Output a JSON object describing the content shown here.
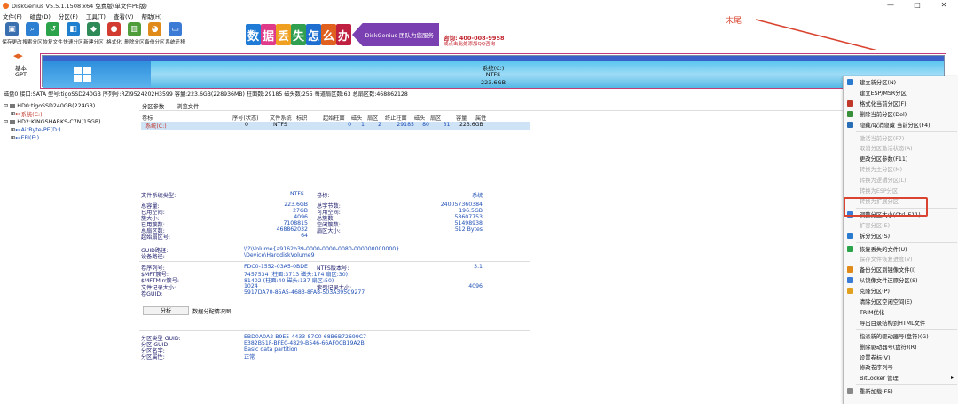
{
  "window": {
    "title": "DiskGenius V5.5.1.1508 x64 免费版(单文件PE版)",
    "minimize": "—",
    "maximize": "□",
    "close": "✕"
  },
  "menu": [
    "文件(F)",
    "磁盘(D)",
    "分区(P)",
    "工具(T)",
    "查看(V)",
    "帮助(H)"
  ],
  "toolbar": [
    {
      "label": "保存更改",
      "icon": "save-icon",
      "color": "#3a6fb0"
    },
    {
      "label": "搜索分区",
      "icon": "search-icon",
      "color": "#2c7fd1"
    },
    {
      "label": "恢复文件",
      "icon": "recover-icon",
      "color": "#2aa34a"
    },
    {
      "label": "快速分区",
      "icon": "quick-partition-icon",
      "color": "#1f7fcf"
    },
    {
      "label": "新建分区",
      "icon": "new-partition-icon",
      "color": "#2e8b57"
    },
    {
      "label": "格式化",
      "icon": "format-icon",
      "color": "#d23b2f"
    },
    {
      "label": "删除分区",
      "icon": "delete-icon",
      "color": "#4f9d3a"
    },
    {
      "label": "备份分区",
      "icon": "backup-icon",
      "color": "#e08a1a"
    },
    {
      "label": "系统迁移",
      "icon": "migrate-icon",
      "color": "#3b7bd6"
    }
  ],
  "banner": {
    "chars": [
      "数",
      "据",
      "丢",
      "失",
      "怎",
      "么",
      "办"
    ],
    "colors": [
      "#1f7bd6",
      "#e03a8a",
      "#f0a020",
      "#30a050",
      "#1f6fd0",
      "#e06020",
      "#c02040"
    ],
    "slogan": "DiskGenius 团队为您服务",
    "phone": "咨询: 400-008-9958",
    "qq": "或点击此处添加QQ咨询"
  },
  "annotation": "末尾",
  "disk_left": {
    "line1": "基本",
    "line2": "GPT"
  },
  "partition_bar": {
    "name": "系统(C:)",
    "fs": "NTFS",
    "size": "223.6GB"
  },
  "disk_info": "磁盘0 接口:SATA  型号:tigoSSD240GB  序列号:RZI9524202H3599  容量:223.6GB(228936MB)  柱面数:29185  磁头数:255  每道扇区数:63  总扇区数:468862128",
  "tree": [
    {
      "text": "HD0:tigoSSD240GB(224GB)",
      "indent": 0,
      "icon": "disk-icon"
    },
    {
      "text": "系统(C:)",
      "indent": 1,
      "icon": "partition-icon",
      "selected": true
    },
    {
      "text": "HD2:KINGSHARKS-C7N(15GB)",
      "indent": 0,
      "icon": "disk-icon"
    },
    {
      "text": "AirByte-PE(D:)",
      "indent": 1,
      "icon": "partition-icon"
    },
    {
      "text": "EFI(E:)",
      "indent": 1,
      "icon": "partition-icon"
    }
  ],
  "tabs": [
    "分区参数",
    "浏览文件"
  ],
  "table": {
    "headers": [
      "卷标",
      "序号(状态)",
      "文件系统",
      "标识",
      "起始柱面",
      "磁头",
      "扇区",
      "终止柱面",
      "磁头",
      "扇区",
      "容量",
      "属性"
    ],
    "row": [
      "系统(C:)",
      "0",
      "NTFS",
      "",
      "0",
      "1",
      "2",
      "29185",
      "80",
      "31",
      "223.6GB",
      ""
    ]
  },
  "fs_info": {
    "fs_type_label": "文件系统类型:",
    "fs_type": "NTFS",
    "vol_label_label": "卷标:",
    "vol_label": "系统",
    "rows": [
      [
        "总容量:",
        "223.6GB",
        "总字节数:",
        "240057360384"
      ],
      [
        "已用空间:",
        "27GB",
        "可用空间:",
        "196.5GB"
      ],
      [
        "簇大小:",
        "4096",
        "总簇数:",
        "58607753"
      ],
      [
        "已用簇数:",
        "7108815",
        "空闲簇数:",
        "51498938"
      ],
      [
        "总扇区数:",
        "468862032",
        "扇区大小:",
        "512 Bytes"
      ],
      [
        "起始扇区号:",
        "64",
        "",
        ""
      ]
    ],
    "guid_path_label": "GUID路径:",
    "guid_path": "\\\\?\\Volume{a9162b39-0000-0000-0080-000000000000}",
    "device_path_label": "设备路径:",
    "device_path": "\\Device\\HarddiskVolume9",
    "rows2": [
      [
        "卷序列号:",
        "FDC0-1552-03A5-0BDE",
        "NTFS版本号:",
        "3.1"
      ],
      [
        "$MFT簇号:",
        "7457534 (柱面:3713 磁头:174 扇区:30)",
        "",
        ""
      ],
      [
        "$MFTMirr簇号:",
        "81402 (柱面:40 磁头:137 扇区:50)",
        "",
        ""
      ],
      [
        "文件记录大小:",
        "1024",
        "索引记录大小:",
        "4096"
      ],
      [
        "卷GUID:",
        "5917DA70-85A5-4683-8FA8-503A395C9277",
        "",
        ""
      ]
    ],
    "analyze_button": "分析",
    "analyze_label": "数据分配情况图:",
    "rows3": [
      [
        "分区类型 GUID:",
        "EBD0A0A2-B9E5-4433-87C0-68B6B72699C7"
      ],
      [
        "分区 GUID:",
        "E382B51F-BFE0-4829-B546-66AF0CB19A2B"
      ],
      [
        "分区名字:",
        "Basic data partition"
      ],
      [
        "分区属性:",
        "正常"
      ]
    ]
  },
  "context_menu": [
    {
      "label": "建立新分区(N)",
      "enabled": true,
      "color": "#2a7bd0"
    },
    {
      "label": "建立ESP/MSR分区",
      "enabled": true,
      "color": ""
    },
    {
      "label": "格式化当前分区(F)",
      "enabled": true,
      "color": "#c0392b"
    },
    {
      "label": "删除当前分区(Del)",
      "enabled": true,
      "color": "#3a8f3a"
    },
    {
      "label": "隐藏/取消隐藏 当前分区(F4)",
      "enabled": true,
      "color": "#2a6fb5"
    },
    {
      "label": "激活当前分区(F7)",
      "enabled": false,
      "color": ""
    },
    {
      "label": "取消分区激活状态(A)",
      "enabled": false,
      "color": ""
    },
    {
      "label": "更改分区参数(F11)",
      "enabled": true,
      "color": ""
    },
    {
      "label": "转换为主分区(M)",
      "enabled": false,
      "color": ""
    },
    {
      "label": "转换为逻辑分区(L)",
      "enabled": false,
      "color": ""
    },
    {
      "label": "转换为ESP分区",
      "enabled": false,
      "color": ""
    },
    {
      "label": "转换为扩展分区",
      "enabled": false,
      "color": ""
    },
    {
      "label": "调整分区大小(Ctrl_F11)",
      "enabled": true,
      "color": "#3a7bd5"
    },
    {
      "label": "扩容分区(E)",
      "enabled": false,
      "color": ""
    },
    {
      "label": "拆分分区(S)",
      "enabled": true,
      "color": "#2a7bd0"
    },
    {
      "label": "恢复丢失的文件(U)",
      "enabled": true,
      "color": "#2aa34a"
    },
    {
      "label": "保存文件恢复进度(V)",
      "enabled": false,
      "color": ""
    },
    {
      "label": "备份分区到镜像文件(I)",
      "enabled": true,
      "color": "#e08a1a"
    },
    {
      "label": "从镜像文件还原分区(S)",
      "enabled": true,
      "color": "#3a7bd5"
    },
    {
      "label": "克隆分区(P)",
      "enabled": true,
      "color": "#e0a020"
    },
    {
      "label": "清除分区空闲空间(E)",
      "enabled": true,
      "color": ""
    },
    {
      "label": "TRIM优化",
      "enabled": true,
      "color": ""
    },
    {
      "label": "导出目录结构到HTML文件",
      "enabled": true,
      "color": ""
    },
    {
      "label": "指派新的驱动器号(盘符)(G)",
      "enabled": true,
      "color": ""
    },
    {
      "label": "删除驱动器号(盘符)(R)",
      "enabled": true,
      "color": ""
    },
    {
      "label": "设置卷标(V)",
      "enabled": true,
      "color": ""
    },
    {
      "label": "修改卷序列号",
      "enabled": true,
      "color": ""
    },
    {
      "label": "BitLocker 管理",
      "enabled": true,
      "color": ""
    },
    {
      "label": "重新加载(F5)",
      "enabled": true,
      "color": "#888888"
    }
  ]
}
